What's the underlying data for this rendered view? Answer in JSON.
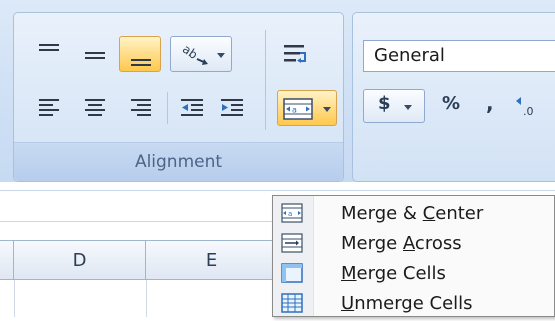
{
  "ribbon": {
    "alignment_group": {
      "label": "Alignment",
      "buttons": {
        "top_align": "top-align-icon",
        "middle_align": "middle-align-icon",
        "bottom_align": "bottom-align-icon",
        "orientation": "orientation-icon",
        "align_left": "align-left-icon",
        "center": "align-center-icon",
        "align_right": "align-right-icon",
        "decrease_indent": "decrease-indent-icon",
        "increase_indent": "increase-indent-icon",
        "wrap_text": "wrap-text-icon",
        "merge_center": "merge-center-icon"
      },
      "active_button": "bottom_align"
    },
    "number_group": {
      "format_value": "General",
      "currency_label": "$",
      "percent_label": "%",
      "comma_label": ","
    }
  },
  "sheet": {
    "columns": [
      "D",
      "E"
    ]
  },
  "merge_menu": {
    "items": [
      {
        "pre": "Merge & ",
        "key": "C",
        "post": "enter",
        "icon": "merge-center-icon"
      },
      {
        "pre": "Merge ",
        "key": "A",
        "post": "cross",
        "icon": "merge-across-icon"
      },
      {
        "pre": "",
        "key": "M",
        "post": "erge Cells",
        "icon": "merge-cells-icon"
      },
      {
        "pre": "",
        "key": "U",
        "post": "nmerge Cells",
        "icon": "unmerge-cells-icon"
      }
    ]
  },
  "colors": {
    "ribbon_bg": "#cfe0f5",
    "active_button": "#ffc84c",
    "menu_bg": "#fafafa"
  }
}
